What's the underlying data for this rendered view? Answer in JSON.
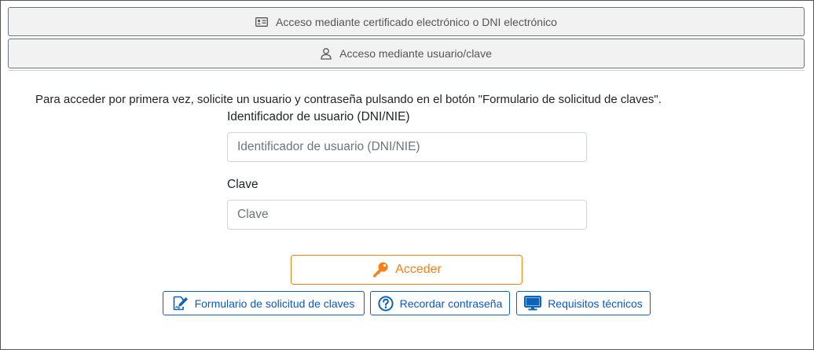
{
  "accordion": {
    "certificate_label": "Acceso mediante certificado electrónico o DNI electrónico",
    "userpass_label": "Acceso mediante usuario/clave"
  },
  "form": {
    "intro": "Para acceder por primera vez, solicite un usuario y contraseña pulsando en el botón \"Formulario de solicitud de claves\".",
    "user_label": "Identificador de usuario (DNI/NIE)",
    "user_placeholder": "Identificador de usuario (DNI/NIE)",
    "user_value": "",
    "password_label": "Clave",
    "password_placeholder": "Clave",
    "password_value": "",
    "submit_label": "Acceder"
  },
  "links": {
    "form_request_label": "Formulario de solicitud de claves",
    "remember_password_label": "Recordar contraseña",
    "requirements_label": "Requisitos técnicos"
  },
  "icons": {
    "certificate": "id-card-icon",
    "user": "user-icon",
    "submit": "key-icon",
    "form_request": "edit-document-icon",
    "remember": "question-circle-icon",
    "requirements": "monitor-icon"
  },
  "colors": {
    "accent_orange": "#fd7e14",
    "link_blue": "#0d63b8",
    "accordion_bg": "#f2f2f2"
  }
}
